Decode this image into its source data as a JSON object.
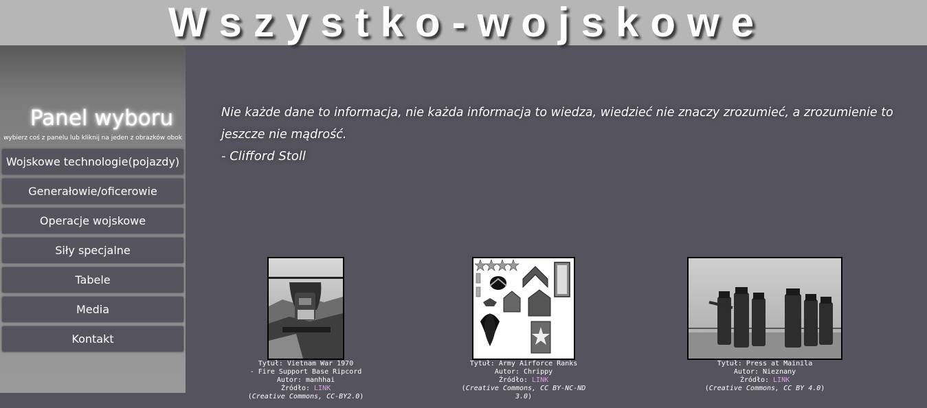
{
  "header": {
    "title": "Wszystko-wojskowe"
  },
  "sidebar": {
    "title": "Panel wyboru",
    "subtitle": "wybierz coś z panelu lub kliknij na jeden z obrazków obok",
    "items": [
      {
        "label": "Wojskowe technologie(pojazdy)"
      },
      {
        "label": "Generałowie/oficerowie"
      },
      {
        "label": "Operacje wojskowe"
      },
      {
        "label": "Siły specjalne"
      },
      {
        "label": "Tabele"
      },
      {
        "label": "Media"
      },
      {
        "label": "Kontakt"
      }
    ]
  },
  "quote": {
    "text": "Nie każde dane to informacja, nie każda informacja to wiedza, wiedzieć nie znaczy zrozumieć, a zrozumienie to jeszcze nie mądrość.",
    "author": "- Clifford Stoll"
  },
  "gallery": [
    {
      "title_line1": "Tytuł: Vietnam War 1970",
      "title_line2": "- Fire Support Base Ripcord",
      "author": "Autor: manhhai",
      "source_label": "Źródło: ",
      "source_link": "LINK",
      "license": "Creative Commons, CC-BY2.0"
    },
    {
      "title_line1": "Tytuł: Army Airforce Ranks",
      "author": "Autor: Chrippy",
      "source_label": "Źródło: ",
      "source_link": "LINK",
      "license": "Creative Commons, CC BY-NC-ND 3.0"
    },
    {
      "title_line1": "Tytuł: Press at Mainila",
      "author": "Autor: Nieznany",
      "source_label": "Źródło: ",
      "source_link": "LINK",
      "license": "Creative Commons, CC BY 4.0"
    }
  ]
}
